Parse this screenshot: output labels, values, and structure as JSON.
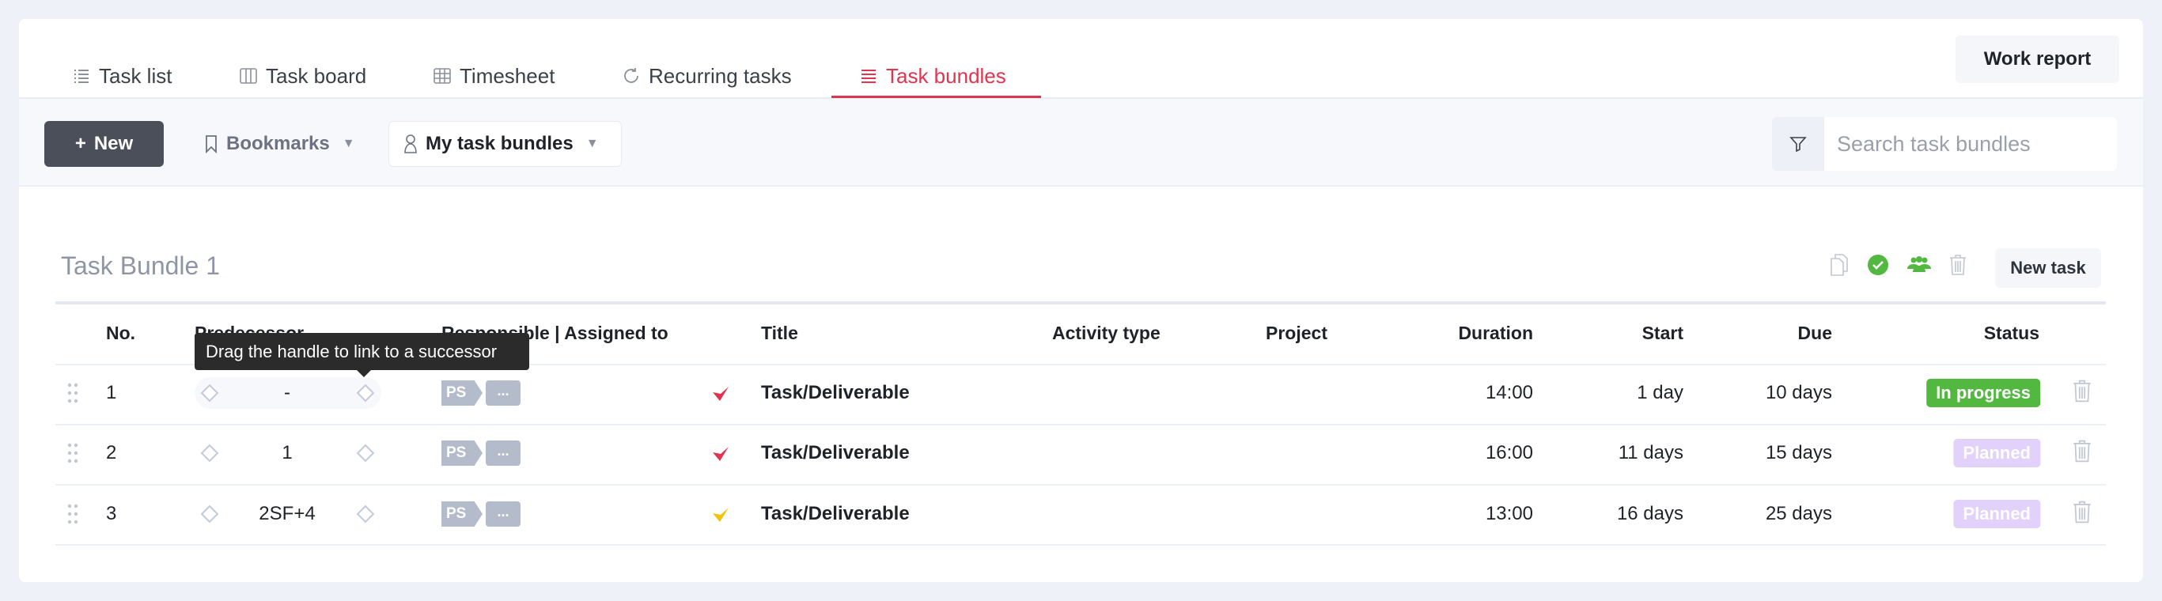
{
  "tabs": [
    {
      "label": "Task list",
      "icon": "list-icon",
      "active": false
    },
    {
      "label": "Task board",
      "icon": "board-icon",
      "active": false
    },
    {
      "label": "Timesheet",
      "icon": "grid-icon",
      "active": false
    },
    {
      "label": "Recurring tasks",
      "icon": "refresh-icon",
      "active": false
    },
    {
      "label": "Task bundles",
      "icon": "bundle-list-icon",
      "active": true
    }
  ],
  "work_report_label": "Work report",
  "toolbar": {
    "new_label": "New",
    "bookmarks_label": "Bookmarks",
    "filter_label": "My task bundles",
    "search_placeholder": "Search task bundles"
  },
  "bundle": {
    "title": "Task Bundle 1",
    "new_task_label": "New task",
    "columns": {
      "no": "No.",
      "predecessor": "Predecessor",
      "responsible": "Responsible | Assigned to",
      "title": "Title",
      "activity": "Activity type",
      "project": "Project",
      "duration": "Duration",
      "start": "Start",
      "due": "Due",
      "status": "Status"
    },
    "tooltip": "Drag the handle to link to a successor",
    "rows": [
      {
        "no": "1",
        "predecessor": "-",
        "responsible": "PS",
        "more": "...",
        "check_color": "#e2344f",
        "title": "Task/Deliverable",
        "activity": "",
        "project": "",
        "duration": "14:00",
        "start": "1 day",
        "due": "10 days",
        "status": "In progress",
        "status_color": "#52b840"
      },
      {
        "no": "2",
        "predecessor": "1",
        "responsible": "PS",
        "more": "...",
        "check_color": "#e2344f",
        "title": "Task/Deliverable",
        "activity": "",
        "project": "",
        "duration": "16:00",
        "start": "11 days",
        "due": "15 days",
        "status": "Planned",
        "status_color": "#e2d2fb"
      },
      {
        "no": "3",
        "predecessor": "2SF+4",
        "responsible": "PS",
        "more": "...",
        "check_color": "#f5c400",
        "title": "Task/Deliverable",
        "activity": "",
        "project": "",
        "duration": "13:00",
        "start": "16 days",
        "due": "25 days",
        "status": "Planned",
        "status_color": "#e2d2fb"
      }
    ]
  },
  "colors": {
    "accent": "#e2344f",
    "success": "#52b840",
    "planned": "#e2d2fb"
  }
}
